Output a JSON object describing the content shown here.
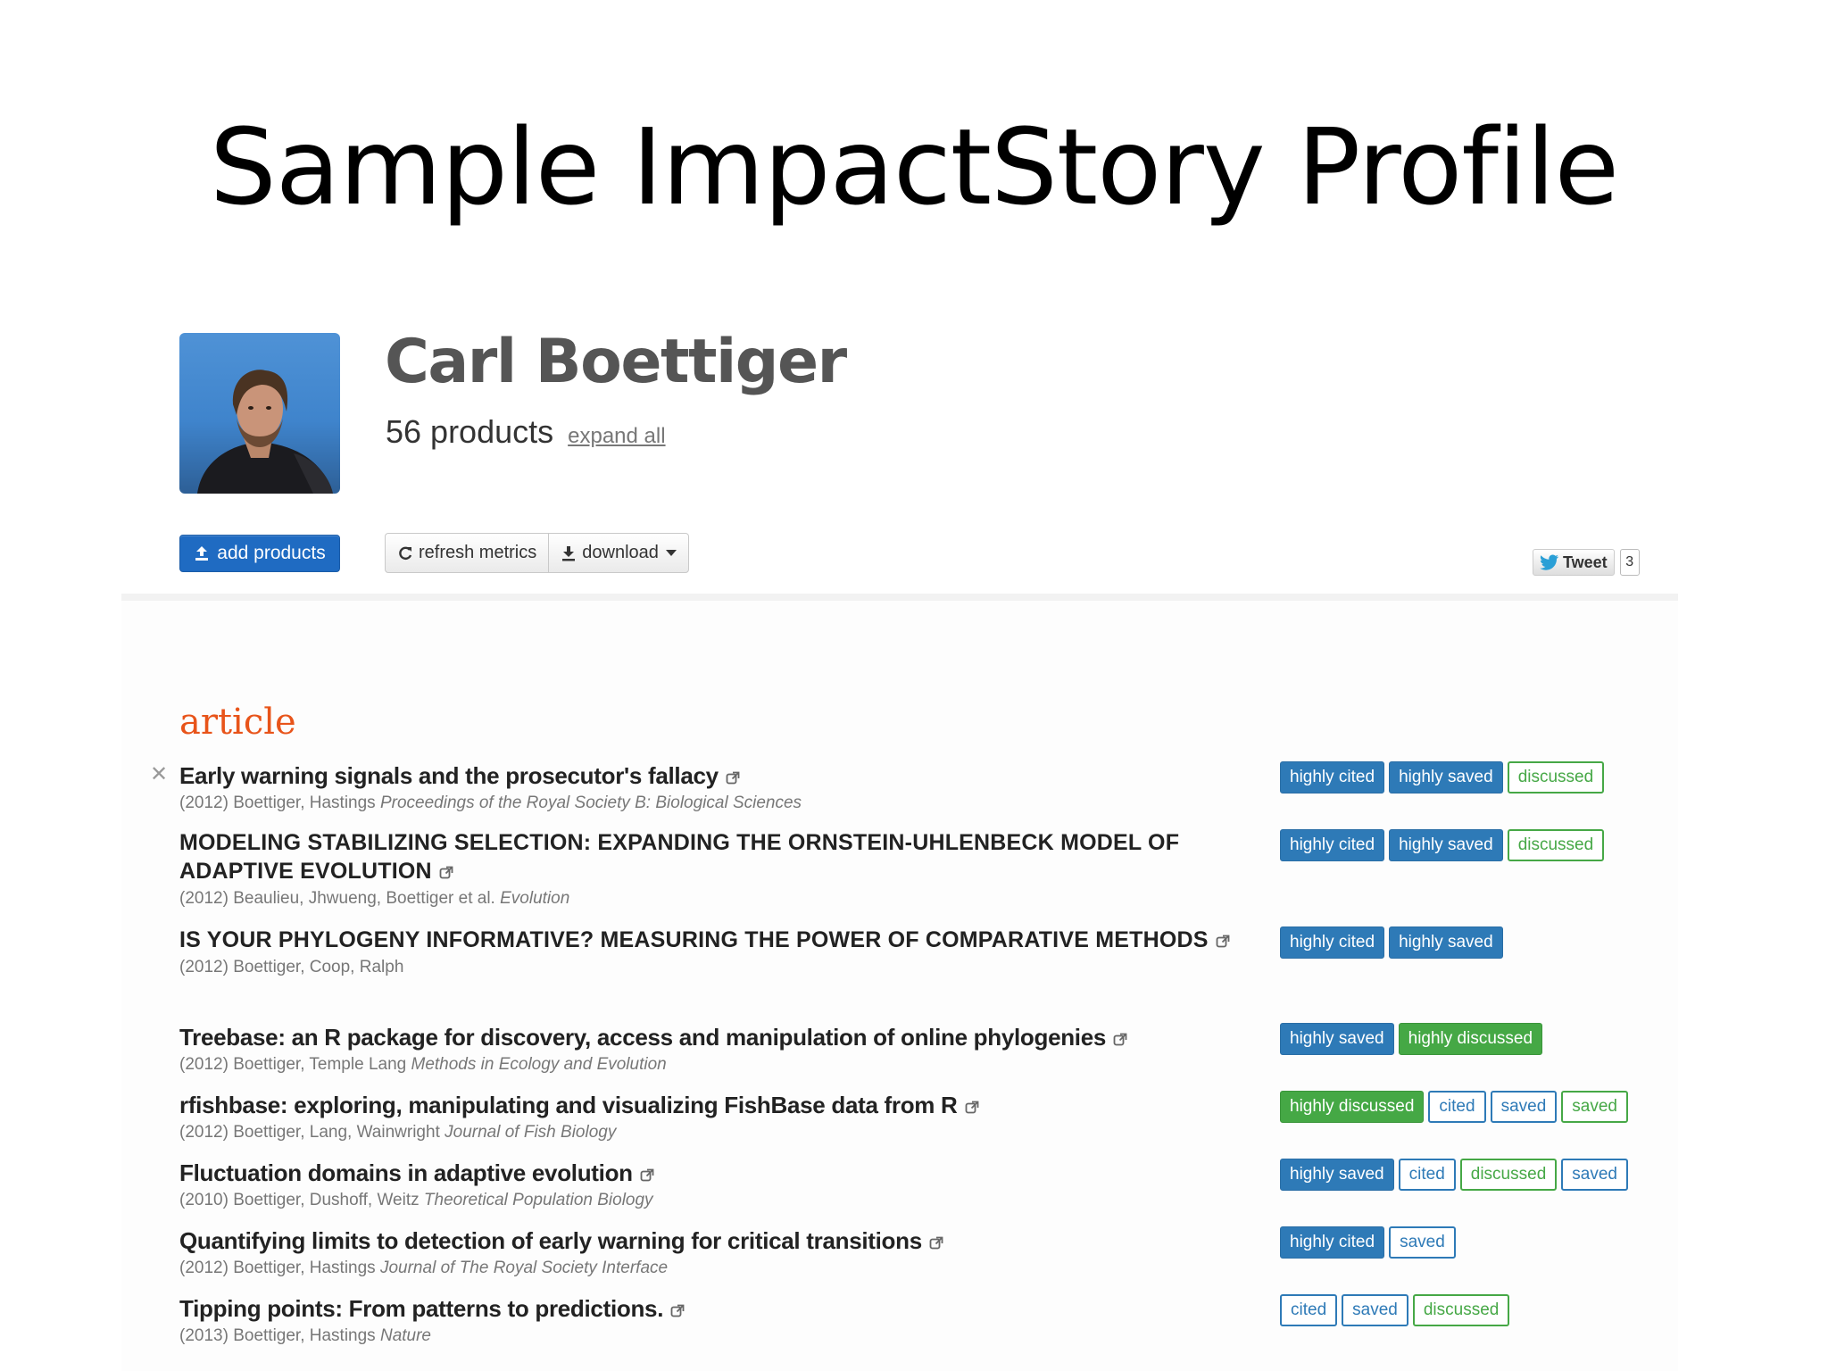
{
  "slide": {
    "title": "Sample ImpactStory Profile"
  },
  "profile": {
    "name": "Carl Boettiger",
    "products_count": "56 products",
    "expand_all": "expand all",
    "add_products": "add products",
    "refresh_metrics": "refresh metrics",
    "download": "download",
    "tweet_label": "Tweet",
    "tweet_count": "3"
  },
  "section": {
    "heading": "article"
  },
  "articles": [
    {
      "title": "Early warning signals and the prosecutor's fallacy",
      "year": "(2012)",
      "authors": "Boettiger, Hastings",
      "venue": "Proceedings of the Royal Society B: Biological Sciences",
      "badges": [
        "highly cited",
        "highly saved",
        "discussed"
      ]
    },
    {
      "title": "MODELING STABILIZING SELECTION: EXPANDING THE ORNSTEIN-UHLENBECK MODEL OF ADAPTIVE EVOLUTION",
      "year": "(2012)",
      "authors": "Beaulieu, Jhwueng, Boettiger et al.",
      "venue": "Evolution",
      "badges": [
        "highly cited",
        "highly saved",
        "discussed"
      ]
    },
    {
      "title": "IS YOUR PHYLOGENY INFORMATIVE? MEASURING THE POWER OF COMPARATIVE METHODS",
      "year": "(2012)",
      "authors": "Boettiger, Coop, Ralph",
      "venue": "",
      "badges": [
        "highly cited",
        "highly saved"
      ]
    },
    {
      "title": "Treebase: an R package for discovery, access and manipulation of online phylogenies",
      "year": "(2012)",
      "authors": "Boettiger, Temple Lang",
      "venue": "Methods in Ecology and Evolution",
      "badges": [
        "highly saved",
        "highly discussed"
      ]
    },
    {
      "title": "rfishbase: exploring, manipulating and visualizing FishBase data from R",
      "year": "(2012)",
      "authors": "Boettiger, Lang, Wainwright",
      "venue": "Journal of Fish Biology",
      "badges": [
        "highly discussed",
        "cited",
        "saved",
        "saved"
      ]
    },
    {
      "title": "Fluctuation domains in adaptive evolution",
      "year": "(2010)",
      "authors": "Boettiger, Dushoff, Weitz",
      "venue": "Theoretical Population Biology",
      "badges": [
        "highly saved",
        "cited",
        "discussed",
        "saved"
      ]
    },
    {
      "title": "Quantifying limits to detection of early warning for critical transitions",
      "year": "(2012)",
      "authors": "Boettiger, Hastings",
      "venue": "Journal of The Royal Society Interface",
      "badges": [
        "highly cited",
        "saved"
      ]
    },
    {
      "title": "Tipping points: From patterns to predictions.",
      "year": "(2013)",
      "authors": "Boettiger, Hastings",
      "venue": "Nature",
      "badges": [
        "cited",
        "saved",
        "discussed"
      ]
    }
  ],
  "colors": {
    "accent_orange": "#e8541a",
    "blue": "#2e7ab7",
    "green": "#45a845",
    "add_button": "#1f6bc2"
  }
}
